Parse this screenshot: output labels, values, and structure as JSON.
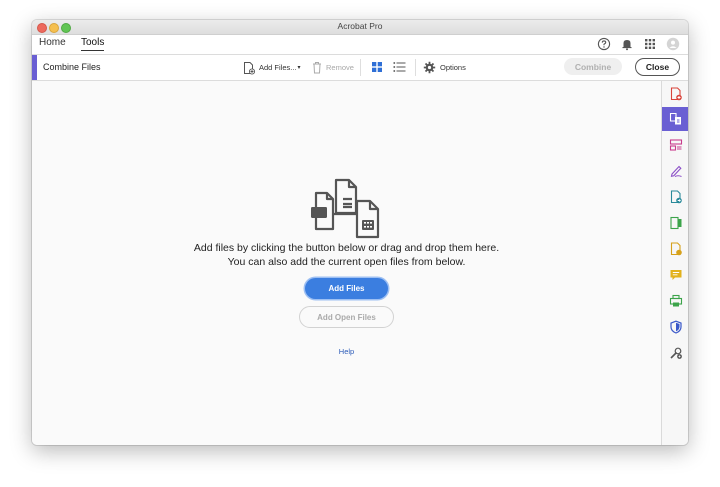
{
  "window": {
    "title": "Acrobat Pro"
  },
  "nav": {
    "tabs": [
      {
        "label": "Home"
      },
      {
        "label": "Tools"
      }
    ],
    "active_tab": "Tools"
  },
  "toolbar": {
    "tool_name": "Combine Files",
    "add_files_label": "Add Files...",
    "remove_label": "Remove",
    "options_label": "Options",
    "combine_label": "Combine",
    "close_label": "Close"
  },
  "main": {
    "message_line1": "Add files by clicking the button below or drag and drop them here.",
    "message_line2": "You can also add the current open files from below.",
    "add_files_button": "Add Files",
    "add_open_files_button": "Add Open Files",
    "help_link": "Help"
  },
  "rightbar": {
    "icons": [
      "create-pdf-icon",
      "combine-files-icon",
      "organize-pages-icon",
      "fill-sign-icon",
      "export-pdf-icon",
      "edit-pdf-icon",
      "enhance-scans-icon",
      "comment-icon",
      "print-production-icon",
      "protect-icon",
      "more-tools-icon"
    ]
  },
  "colors": {
    "accent": "#6a5fd3",
    "primary_button": "#3b7ee0",
    "link": "#2b5bb8"
  }
}
